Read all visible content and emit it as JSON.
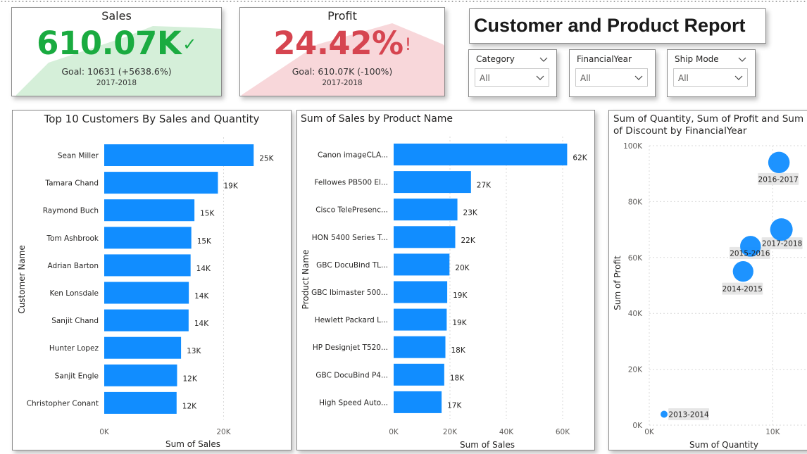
{
  "report": {
    "title": "Customer and Product Report"
  },
  "kpi_sales": {
    "title": "Sales",
    "value": "610.07K",
    "status_icon": "check-icon",
    "goal": "Goal: 10631 (+5638.6%)",
    "period": "2017-2018",
    "colors": {
      "value": "#1aab40",
      "fill": "#d5efd9"
    }
  },
  "kpi_profit": {
    "title": "Profit",
    "value": "24.42%",
    "status_icon": "exclamation-icon",
    "goal": "Goal: 610.07K (-100%)",
    "period": "2017-2018",
    "colors": {
      "value": "#d64550",
      "fill": "#f8d7da"
    }
  },
  "slicers": [
    {
      "label": "Category",
      "value": "All"
    },
    {
      "label": "FinancialYear",
      "value": "All"
    },
    {
      "label": "Ship Mode",
      "value": "All"
    }
  ],
  "colors": {
    "bar": "#118dff",
    "grid": "#d9d9d9"
  },
  "chart_data": [
    {
      "type": "bar",
      "orientation": "horizontal",
      "title": "Top 10 Customers By Sales and Quantity",
      "xlabel": "Sum of Sales",
      "ylabel": "Customer Name",
      "categories": [
        "Sean Miller",
        "Tamara Chand",
        "Raymond Buch",
        "Tom Ashbrook",
        "Adrian Barton",
        "Ken Lonsdale",
        "Sanjit Chand",
        "Hunter Lopez",
        "Sanjit Engle",
        "Christopher Conant"
      ],
      "values": [
        25043,
        19052,
        15117,
        14596,
        14474,
        14175,
        14142,
        12873,
        12209,
        12129
      ],
      "data_labels": [
        "25K",
        "19K",
        "15K",
        "15K",
        "14K",
        "14K",
        "14K",
        "13K",
        "12K",
        "12K"
      ],
      "xlim": [
        0,
        29500
      ],
      "xticks": [
        0,
        20000
      ],
      "xtick_labels": [
        "0K",
        "20K"
      ],
      "grid": true
    },
    {
      "type": "bar",
      "orientation": "horizontal",
      "title": "Sum of Sales by Product Name",
      "xlabel": "Sum of Sales",
      "ylabel": "Product Name",
      "categories": [
        "Canon imageCLA...",
        "Fellowes PB500 El...",
        "Cisco TelePresenc...",
        "HON 5400 Series T...",
        "GBC DocuBind TL...",
        "GBC Ibimaster 500...",
        "Hewlett Packard L...",
        "HP Designjet T520...",
        "GBC DocuBind P4...",
        "High Speed Auto..."
      ],
      "values": [
        61600,
        27453,
        22638,
        21870,
        19823,
        19024,
        18840,
        18375,
        17965,
        17030
      ],
      "data_labels": [
        "62K",
        "27K",
        "23K",
        "22K",
        "20K",
        "19K",
        "19K",
        "18K",
        "18K",
        "17K"
      ],
      "xlim": [
        0,
        66500
      ],
      "xticks": [
        0,
        20000,
        40000,
        60000
      ],
      "xtick_labels": [
        "0K",
        "20K",
        "40K",
        "60K"
      ],
      "grid": true
    },
    {
      "type": "scatter",
      "title": "Sum of Quantity, Sum of Profit and Sum of Discount by FinancialYear",
      "xlabel": "Sum of Quantity",
      "ylabel": "Sum of Profit",
      "points": [
        {
          "label": "2013-2014",
          "x": 1200,
          "y": 3900,
          "size": 0.8
        },
        {
          "label": "2014-2015",
          "x": 7600,
          "y": 55000,
          "size": 90
        },
        {
          "label": "2015-2016",
          "x": 8200,
          "y": 64000,
          "size": 92
        },
        {
          "label": "2016-2017",
          "x": 10500,
          "y": 94000,
          "size": 98
        },
        {
          "label": "2017-2018",
          "x": 10700,
          "y": 70000,
          "size": 108
        }
      ],
      "xlim": [
        0,
        13000
      ],
      "ylim": [
        0,
        100000
      ],
      "xticks": [
        0,
        10000
      ],
      "xtick_labels": [
        "0K",
        "10K"
      ],
      "yticks": [
        0,
        20000,
        40000,
        60000,
        80000,
        100000
      ],
      "ytick_labels": [
        "0K",
        "20K",
        "40K",
        "60K",
        "80K",
        "100K"
      ],
      "grid": true
    }
  ]
}
